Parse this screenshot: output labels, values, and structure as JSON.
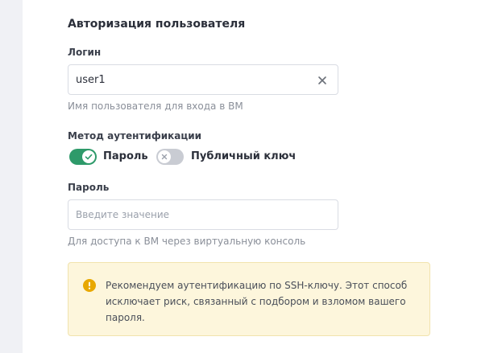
{
  "section": {
    "title": "Авторизация пользователя"
  },
  "login": {
    "label": "Логин",
    "value": "user1",
    "hint": "Имя пользователя для входа в ВМ"
  },
  "auth_method": {
    "label": "Метод аутентификации",
    "password_option": {
      "label": "Пароль",
      "enabled": true
    },
    "public_key_option": {
      "label": "Публичный ключ",
      "enabled": false
    }
  },
  "password": {
    "label": "Пароль",
    "placeholder": "Введите значение",
    "value": "",
    "hint": "Для доступа к ВМ через виртуальную консоль"
  },
  "notice": {
    "icon": "warning-icon",
    "text": "Рекомендуем аутентификацию по SSH-ключу. Этот способ исключает риск, связанный с подбором и взломом вашего пароля."
  },
  "colors": {
    "toggle_on": "#2e9a6a",
    "toggle_off": "#c9ccd3",
    "warning": "#e8a800",
    "notice_bg": "#fdf6dc"
  }
}
